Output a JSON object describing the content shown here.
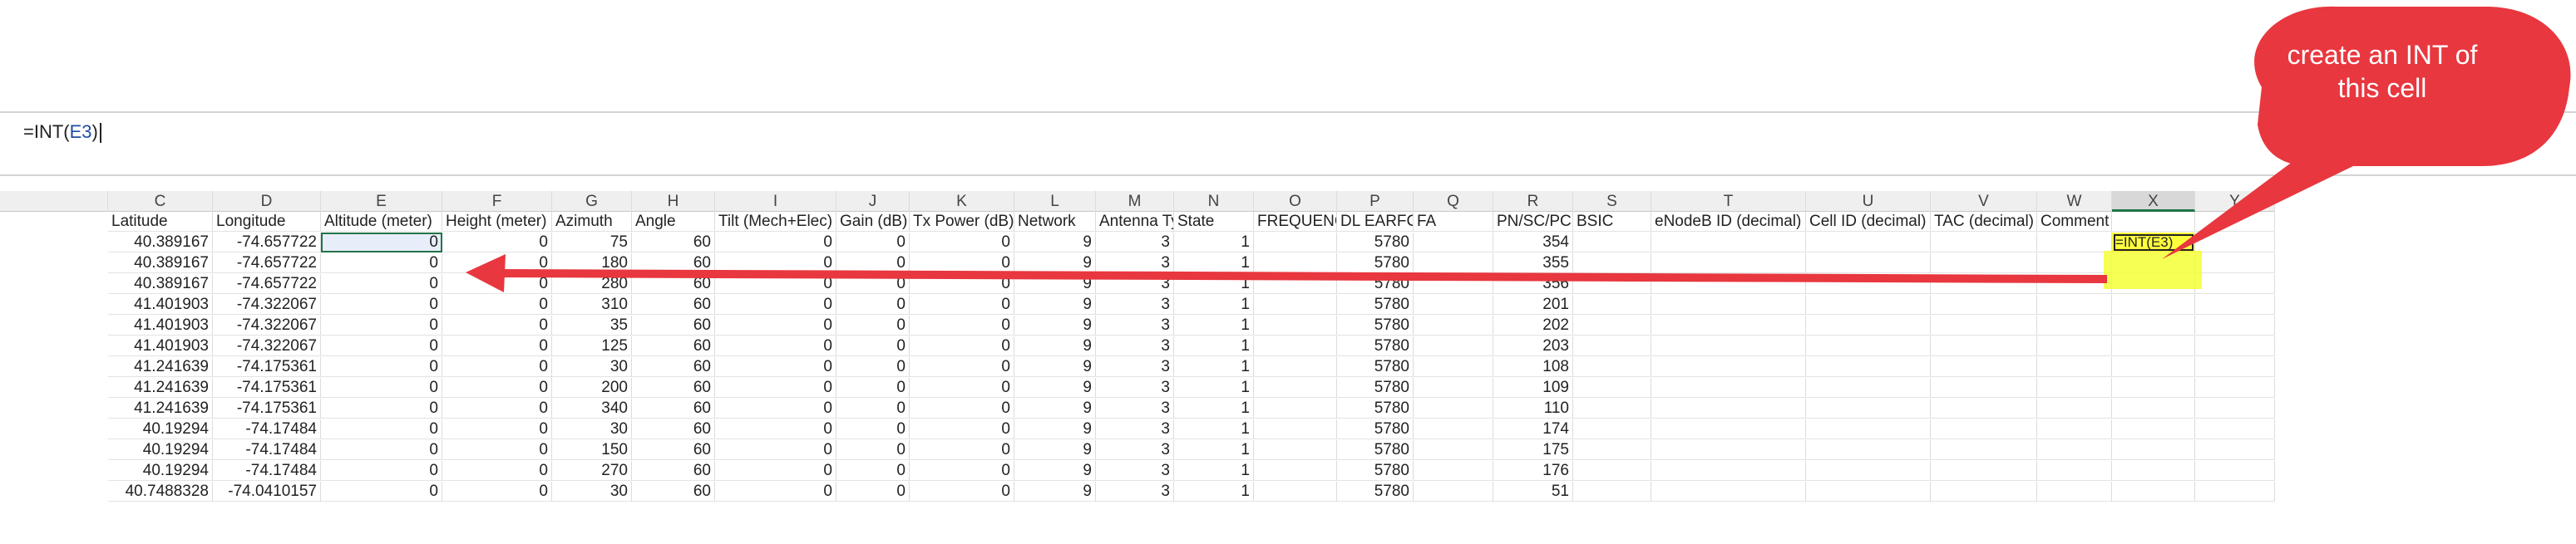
{
  "formula_bar": {
    "prefix": "=INT(",
    "ref": "E3",
    "suffix": ")"
  },
  "columns": [
    "C",
    "D",
    "E",
    "F",
    "G",
    "H",
    "I",
    "J",
    "K",
    "L",
    "M",
    "N",
    "O",
    "P",
    "Q",
    "R",
    "S",
    "T",
    "U",
    "V",
    "W",
    "X",
    "Y"
  ],
  "header_labels": [
    "Latitude",
    "Longitude",
    "Altitude (meter)",
    "Height (meter)",
    "Azimuth",
    "Angle",
    "Tilt (Mech+Elec)",
    "Gain (dB)",
    "Tx Power (dB)",
    "Network",
    "Antenna Type",
    "State",
    "FREQUENCY",
    "DL EARFCN",
    "FA",
    "PN/SC/PCI",
    "BSIC",
    "eNodeB ID (decimal)",
    "Cell ID (decimal)",
    "TAC (decimal)",
    "Comment",
    "",
    ""
  ],
  "rows": [
    [
      "40.389167",
      "-74.657722",
      "0",
      "0",
      "75",
      "60",
      "0",
      "0",
      "0",
      "9",
      "3",
      "1",
      "",
      "5780",
      "",
      "354"
    ],
    [
      "40.389167",
      "-74.657722",
      "0",
      "0",
      "180",
      "60",
      "0",
      "0",
      "0",
      "9",
      "3",
      "1",
      "",
      "5780",
      "",
      "355"
    ],
    [
      "40.389167",
      "-74.657722",
      "0",
      "0",
      "280",
      "60",
      "0",
      "0",
      "0",
      "9",
      "3",
      "1",
      "",
      "5780",
      "",
      "356"
    ],
    [
      "41.401903",
      "-74.322067",
      "0",
      "0",
      "310",
      "60",
      "0",
      "0",
      "0",
      "9",
      "3",
      "1",
      "",
      "5780",
      "",
      "201"
    ],
    [
      "41.401903",
      "-74.322067",
      "0",
      "0",
      "35",
      "60",
      "0",
      "0",
      "0",
      "9",
      "3",
      "1",
      "",
      "5780",
      "",
      "202"
    ],
    [
      "41.401903",
      "-74.322067",
      "0",
      "0",
      "125",
      "60",
      "0",
      "0",
      "0",
      "9",
      "3",
      "1",
      "",
      "5780",
      "",
      "203"
    ],
    [
      "41.241639",
      "-74.175361",
      "0",
      "0",
      "30",
      "60",
      "0",
      "0",
      "0",
      "9",
      "3",
      "1",
      "",
      "5780",
      "",
      "108"
    ],
    [
      "41.241639",
      "-74.175361",
      "0",
      "0",
      "200",
      "60",
      "0",
      "0",
      "0",
      "9",
      "3",
      "1",
      "",
      "5780",
      "",
      "109"
    ],
    [
      "41.241639",
      "-74.175361",
      "0",
      "0",
      "340",
      "60",
      "0",
      "0",
      "0",
      "9",
      "3",
      "1",
      "",
      "5780",
      "",
      "110"
    ],
    [
      "40.19294",
      "-74.17484",
      "0",
      "0",
      "30",
      "60",
      "0",
      "0",
      "0",
      "9",
      "3",
      "1",
      "",
      "5780",
      "",
      "174"
    ],
    [
      "40.19294",
      "-74.17484",
      "0",
      "0",
      "150",
      "60",
      "0",
      "0",
      "0",
      "9",
      "3",
      "1",
      "",
      "5780",
      "",
      "175"
    ],
    [
      "40.19294",
      "-74.17484",
      "0",
      "0",
      "270",
      "60",
      "0",
      "0",
      "0",
      "9",
      "3",
      "1",
      "",
      "5780",
      "",
      "176"
    ],
    [
      "40.7488328",
      "-74.0410157",
      "0",
      "0",
      "30",
      "60",
      "0",
      "0",
      "0",
      "9",
      "3",
      "1",
      "",
      "5780",
      "",
      "51"
    ]
  ],
  "x3_formula": "=INT(E3)",
  "callout": {
    "line1": "create an INT of",
    "line2": "this cell"
  },
  "colors": {
    "arrow": "#e8373f",
    "highlight": "#ffff3d",
    "selection": "#217346"
  }
}
